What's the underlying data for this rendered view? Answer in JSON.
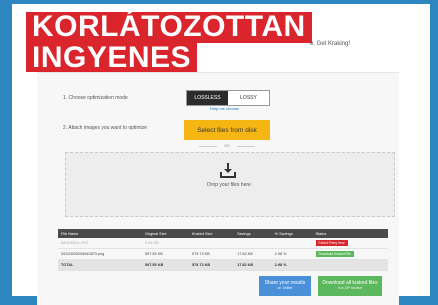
{
  "overlay": {
    "line1": "KORLÁTOZOTTAN",
    "line2": "INGYENES"
  },
  "header": {
    "tagline": "e. Get Kraking!"
  },
  "steps": {
    "step1_label": "1. Choose optimization mode",
    "step2_label": "2. Attach images you want to optimize"
  },
  "mode": {
    "options": [
      "LOSSLESS",
      "LOSSY"
    ],
    "selected": "LOSSLESS",
    "help_link": "Help me choose"
  },
  "upload": {
    "select_button": "Select files from disk",
    "or_label": "OR",
    "drop_text": "Drop your files here"
  },
  "table": {
    "columns": [
      "File Name",
      "Original Size",
      "Kraked Size",
      "Savings",
      "% Savings",
      "Status"
    ],
    "rows": [
      {
        "file": "IMAGE001.JPG",
        "original": "2.93 KB",
        "kraked": "",
        "savings": "",
        "pct": "",
        "status": "Failed! Retry here",
        "status_type": "error"
      },
      {
        "file": "20220505205640873.png",
        "original": "597.55 KB",
        "kraked": "579.73 KB",
        "savings": "17.82 KB",
        "pct": "2.98 %",
        "status": "Download Kraked File",
        "status_type": "success"
      }
    ],
    "total": {
      "label": "TOTAL",
      "original": "597.55 KB",
      "kraked": "579.73 KB",
      "savings": "17.82 KB",
      "pct": "2.98 %"
    }
  },
  "actions": {
    "share_label": "Share your results",
    "share_sub": "on Twitter",
    "download_label": "Download all kraked files",
    "download_sub": "in a ZIP archive"
  },
  "colors": {
    "background": "#2e86c1",
    "badge": "#d9252b",
    "select_button": "#f5b614",
    "share_button": "#4a90d9",
    "download_button": "#5cb85c"
  }
}
